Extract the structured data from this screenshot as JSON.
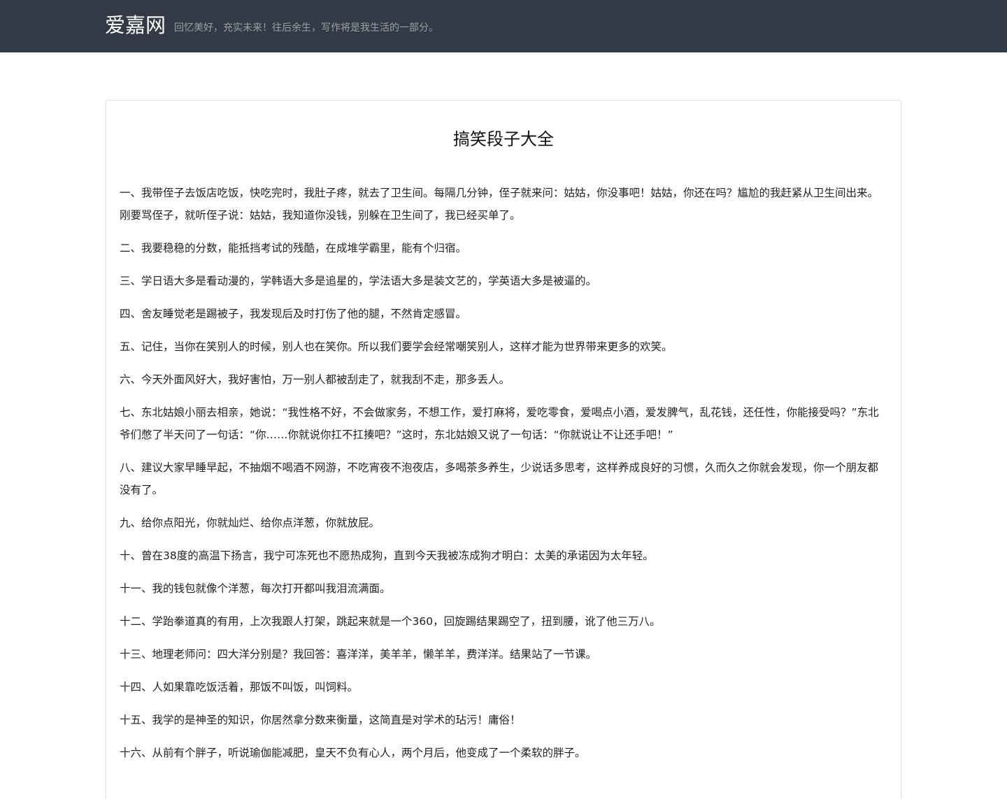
{
  "header": {
    "brand": "爱嘉网",
    "tagline": "回忆美好，充实未来！往后余生，写作将是我生活的一部分。",
    "background_color": "#343a45"
  },
  "article": {
    "title": "搞笑段子大全",
    "paragraphs": [
      "一、我带侄子去饭店吃饭，快吃完时，我肚子疼，就去了卫生间。每隔几分钟，侄子就来问：姑姑，你没事吧！姑姑，你还在吗？尴尬的我赶紧从卫生间出来。刚要骂侄子，就听侄子说：姑姑，我知道你没钱，别躲在卫生间了，我已经买单了。",
      "二、我要稳稳的分数，能抵挡考试的残酷，在成堆学霸里，能有个归宿。",
      "三、学日语大多是看动漫的，学韩语大多是追星的，学法语大多是装文艺的，学英语大多是被逼的。",
      "四、舍友睡觉老是踢被子，我发现后及时打伤了他的腿，不然肯定感冒。",
      "五、记住，当你在笑别人的时候，别人也在笑你。所以我们要学会经常嘲笑别人，这样才能为世界带来更多的欢笑。",
      "六、今天外面风好大，我好害怕，万一别人都被刮走了，就我刮不走，那多丢人。",
      "七、东北姑娘小丽去相亲，她说：“我性格不好，不会做家务，不想工作，爱打麻将，爱吃零食，爱喝点小酒，爱发脾气，乱花钱，还任性，你能接受吗？”东北爷们憋了半天问了一句话：“你……你就说你扛不扛揍吧？”这时，东北姑娘又说了一句话：“你就说让不让还手吧！”",
      "八、建议大家早睡早起，不抽烟不喝酒不网游，不吃宵夜不泡夜店，多喝茶多养生，少说话多思考，这样养成良好的习惯，久而久之你就会发现，你一个朋友都没有了。",
      "九、给你点阳光，你就灿烂、给你点洋葱，你就放屁。",
      "十、曾在38度的高温下扬言，我宁可冻死也不愿热成狗，直到今天我被冻成狗才明白：太美的承诺因为太年轻。",
      "十一、我的钱包就像个洋葱，每次打开都叫我泪流满面。",
      "十二、学跆拳道真的有用，上次我跟人打架，跳起来就是一个360，回旋踢结果踢空了，扭到腰，讹了他三万八。",
      "十三、地理老师问：四大洋分别是？我回答：喜洋洋，美羊羊，懒羊羊，费洋洋。结果站了一节课。",
      "十四、人如果靠吃饭活着，那饭不叫饭，叫饲料。",
      "十五、我学的是神圣的知识，你居然拿分数来衡量，这简直是对学术的玷污！庸俗！",
      "十六、从前有个胖子，听说瑜伽能减肥，皇天不负有心人，两个月后，他变成了一个柔软的胖子。"
    ]
  }
}
